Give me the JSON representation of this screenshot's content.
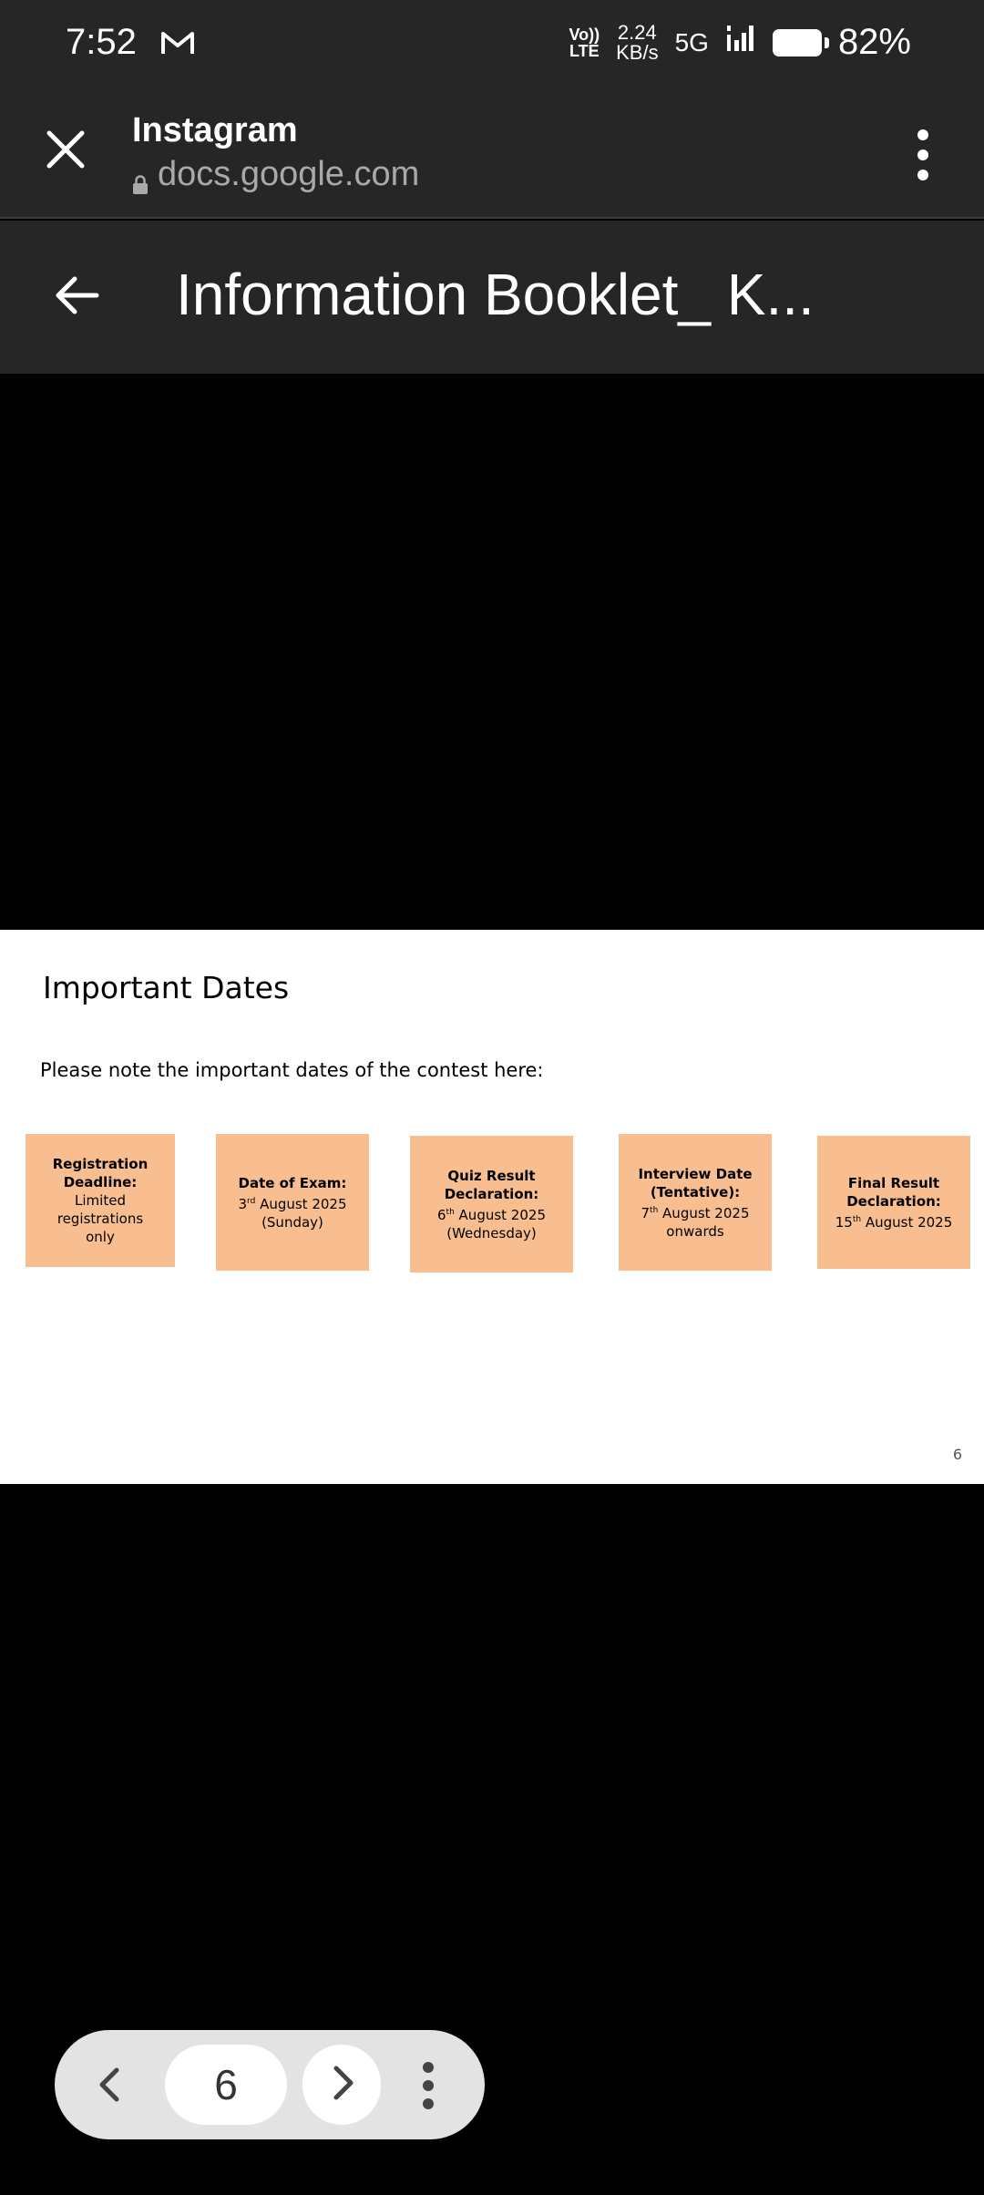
{
  "status_bar": {
    "time": "7:52",
    "volte_top": "Vo))",
    "volte_bottom": "LTE",
    "speed_value": "2.24",
    "speed_unit": "KB/s",
    "network": "5G",
    "battery_percent": "82%",
    "battery_level": 0.82
  },
  "tab_bar": {
    "title": "Instagram",
    "url": "docs.google.com"
  },
  "doc_header": {
    "title": "Information Booklet_ K..."
  },
  "slide": {
    "heading": "Important Dates",
    "intro": "Please note the important dates of the contest here:",
    "page_number": "6",
    "accent_color": "#f8be8f",
    "dates": [
      {
        "label": "Registration Deadline:",
        "lines": [
          "Limited registrations",
          "only"
        ]
      },
      {
        "label": "Date of Exam:",
        "day": "3",
        "suffix": "rd",
        "rest": " August 2025",
        "extra": "(Sunday)"
      },
      {
        "label": "Quiz Result Declaration:",
        "day": "6",
        "suffix": "th",
        "rest": " August 2025",
        "extra": "(Wednesday)"
      },
      {
        "label": "Interview Date (Tentative):",
        "day": "7",
        "suffix": "th",
        "rest": " August 2025",
        "extra": "onwards"
      },
      {
        "label": "Final Result Declaration:",
        "day": "15",
        "suffix": "th",
        "rest": " August 2025",
        "extra": ""
      }
    ]
  },
  "page_nav": {
    "current_page": "6"
  }
}
